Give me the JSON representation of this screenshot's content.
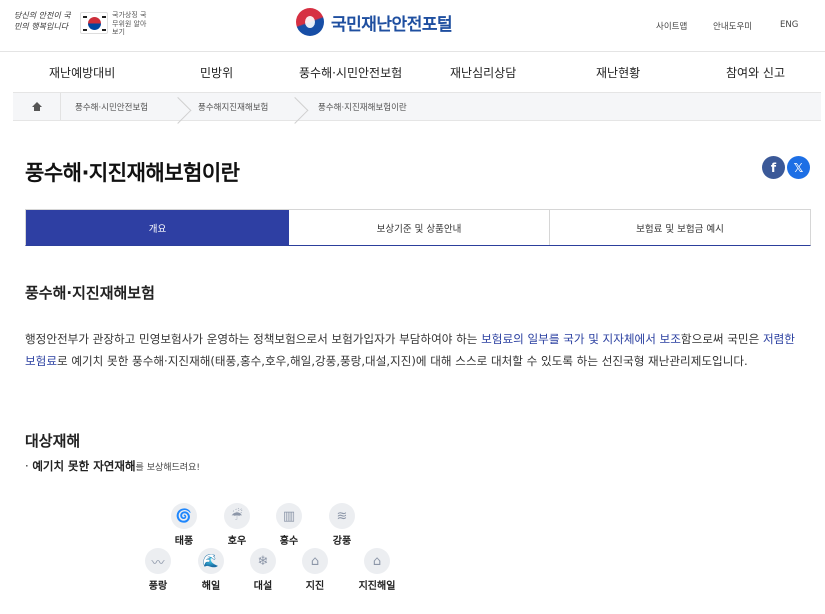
{
  "header": {
    "slogan": "당신의 안전이 국민의 행복입니다",
    "ministry": "국가상징 국무위원 알아보기",
    "brand_title": "국민재난안전포털",
    "util_links": [
      "사이트맵",
      "안내도우미",
      "ENG"
    ]
  },
  "nav": {
    "items": [
      "재난예방대비",
      "민방위",
      "풍수해·시민안전보험",
      "재난심리상담",
      "재난현황",
      "참여와 신고"
    ]
  },
  "breadcrumb": {
    "items": [
      "풍수해·시민안전보험",
      "풍수해지진재해보험",
      "풍수해·지진재해보험이란"
    ]
  },
  "page": {
    "title": "풍수해·지진재해보험이란",
    "share_facebook": "f",
    "share_x": "𝕏"
  },
  "tabs": [
    {
      "label": "개요",
      "active": true
    },
    {
      "label": "보상기준 및 상품안내",
      "active": false
    },
    {
      "label": "보험료 및 보험금 예시",
      "active": false
    }
  ],
  "content": {
    "section1_title": "풍수해·지진재해보험",
    "para_part1": "행정안전부가 관장하고 민영보험사가 운영하는 정책보험으로서 보험가입자가 부담하여야 하는 ",
    "para_hl1": "보험료의 일부를 국가 및 지자체에서 보조",
    "para_part2": "함으로써 국민은 ",
    "para_hl2": "저렴한 보험료",
    "para_part3": "로 예기치 못한 풍수해·지진재해(태풍,홍수,호우,해일,강풍,풍랑,대설,지진)에 대해 스스로 대처할 수 있도록 하는 선진국형 재난관리제도입니다.",
    "section2_title": "대상재해",
    "intro_bullet": "· ",
    "intro_bold": "예기치 못한 자연재해",
    "intro_small": "를 보상해드려요!"
  },
  "disasters": {
    "row1": [
      {
        "label": "태풍",
        "icon": "typhoon-icon"
      },
      {
        "label": "호우",
        "icon": "heavy-rain-icon"
      },
      {
        "label": "홍수",
        "icon": "flood-icon"
      },
      {
        "label": "강풍",
        "icon": "strong-wind-icon"
      }
    ],
    "row2": [
      {
        "label": "풍랑",
        "icon": "high-waves-icon"
      },
      {
        "label": "해일",
        "icon": "tsunami-icon"
      },
      {
        "label": "대설",
        "icon": "heavy-snow-icon"
      },
      {
        "label": "지진",
        "icon": "earthquake-icon"
      },
      {
        "label": "지진해일",
        "icon": "earthquake-tsunami-icon"
      }
    ]
  },
  "colors": {
    "primary": "#2e3fa3",
    "brand": "#1f4fa0",
    "highlight": "#2a3fa0",
    "facebook": "#3b5998"
  }
}
